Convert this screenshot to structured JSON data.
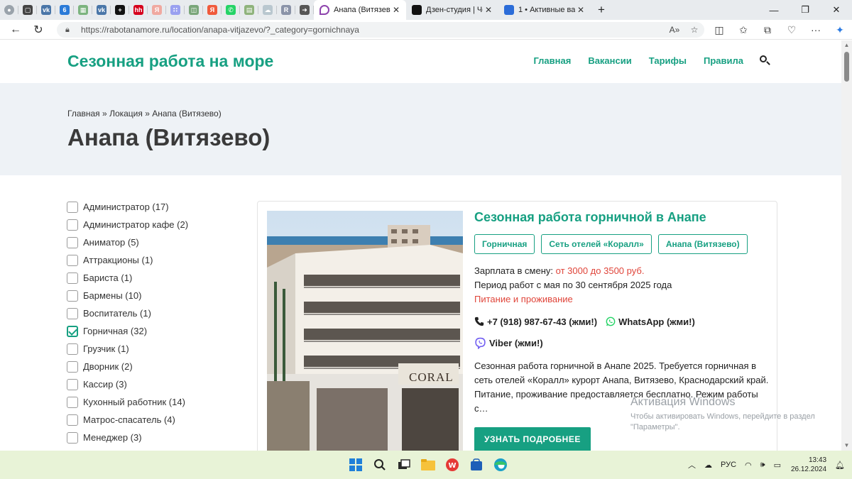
{
  "browser": {
    "pinned_tabs": [
      {
        "name": "profile",
        "color": "#9aa3ab",
        "glyph": "●"
      },
      {
        "name": "workspaces",
        "color": "#444",
        "glyph": "▢"
      },
      {
        "name": "vk",
        "color": "#4a76a8",
        "glyph": "vk"
      },
      {
        "name": "count-six",
        "color": "#2b7bd8",
        "glyph": "6"
      },
      {
        "name": "image",
        "color": "#7cb47f",
        "glyph": "▦"
      },
      {
        "name": "vk2",
        "color": "#4a76a8",
        "glyph": "vk"
      },
      {
        "name": "dzen",
        "color": "#111",
        "glyph": "+"
      },
      {
        "name": "hh",
        "color": "#d6001c",
        "glyph": "hh"
      },
      {
        "name": "yandex",
        "color": "#f0a9a0",
        "glyph": "Я"
      },
      {
        "name": "avito",
        "color": "#9aa0f0",
        "glyph": "∷"
      },
      {
        "name": "photo",
        "color": "#7aa67a",
        "glyph": "◫"
      },
      {
        "name": "yandex2",
        "color": "#f05a3c",
        "glyph": "Я"
      },
      {
        "name": "whatsapp",
        "color": "#25d366",
        "glyph": "✆"
      },
      {
        "name": "sheet",
        "color": "#8fb37c",
        "glyph": "▤"
      },
      {
        "name": "cloud",
        "color": "#b9c7cf",
        "glyph": "☁"
      },
      {
        "name": "rpage",
        "color": "#8a93a8",
        "glyph": "R"
      },
      {
        "name": "arrow",
        "color": "#555",
        "glyph": "➜"
      }
    ],
    "tabs": [
      {
        "title": "Анапа (Витязево) -",
        "active": true,
        "fav_color": "#ffffff"
      },
      {
        "title": "Дзен-студия | Черн",
        "active": false,
        "fav_color": "#111111"
      },
      {
        "title": "1 • Активные ва",
        "active": false,
        "fav_color": "#2b6cd8"
      }
    ],
    "new_tab_glyph": "+",
    "url": "https://rabotanamore.ru/location/anapa-vitjazevo/?_category=gornichnaya"
  },
  "site": {
    "logo": "Сезонная работа на море",
    "nav": [
      "Главная",
      "Вакансии",
      "Тарифы",
      "Правила"
    ],
    "breadcrumb": {
      "home": "Главная",
      "sep": "»",
      "level2": "Локация",
      "current": "Анапа (Витязево)"
    },
    "page_title": "Анапа (Витязево)"
  },
  "filters": [
    {
      "label": "Администратор (17)",
      "checked": false
    },
    {
      "label": "Администратор кафе (2)",
      "checked": false
    },
    {
      "label": "Аниматор (5)",
      "checked": false
    },
    {
      "label": "Аттракционы (1)",
      "checked": false
    },
    {
      "label": "Бариста (1)",
      "checked": false
    },
    {
      "label": "Бармены (10)",
      "checked": false
    },
    {
      "label": "Воспитатель (1)",
      "checked": false
    },
    {
      "label": "Горничная (32)",
      "checked": true
    },
    {
      "label": "Грузчик (1)",
      "checked": false
    },
    {
      "label": "Дворник (2)",
      "checked": false
    },
    {
      "label": "Кассир (3)",
      "checked": false
    },
    {
      "label": "Кухонный работник (14)",
      "checked": false
    },
    {
      "label": "Матрос-спасатель (4)",
      "checked": false
    },
    {
      "label": "Менеджер (3)",
      "checked": false
    }
  ],
  "card": {
    "title": "Сезонная работа горничной в Анапе",
    "tags": [
      "Горничная",
      "Сеть отелей «Коралл»",
      "Анапа (Витязево)"
    ],
    "salary_label": "Зарплата в смену:",
    "salary_value": "от 3000 до 3500 руб.",
    "period": "Период работ с мая по 30 сентября 2025 года",
    "benefits": "Питание и проживание",
    "phone": "+7 (918) 987-67-43 (жми!)",
    "whatsapp": "WhatsApp (жми!)",
    "viber": "Viber (жми!)",
    "description": "Сезонная работа горничной в Анапе 2025. Требуется горничная в сеть отелей «Коралл» курорт Анапа, Витязево, Краснодарский край. Питание, проживание предоставляется бесплатно. Режим работы с…",
    "button": "УЗНАТЬ ПОДРОБНЕЕ",
    "photo_sign": "CORAL"
  },
  "watermark": {
    "title": "Активация Windows",
    "line1": "Чтобы активировать Windows, перейдите в раздел",
    "line2": "\"Параметры\"."
  },
  "taskbar": {
    "lang": "РУС",
    "time": "13:43",
    "date": "26.12.2024"
  },
  "colors": {
    "accent": "#17a082",
    "red": "#e0453a",
    "hero_bg": "#eef2f6"
  }
}
